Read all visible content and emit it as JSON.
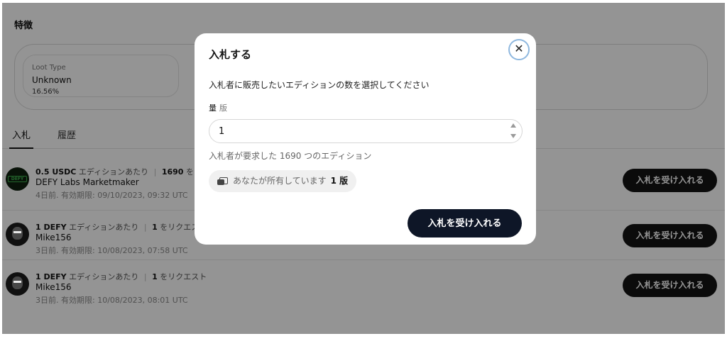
{
  "page": {
    "section_title": "特徴",
    "trait": {
      "type": "Loot Type",
      "value": "Unknown",
      "percent": "16.56%"
    },
    "tabs": [
      {
        "label": "入札",
        "active": true
      },
      {
        "label": "履歴",
        "active": false
      }
    ],
    "bids": [
      {
        "amount": "0.5 USDC",
        "per_edition": "エディションあたり",
        "count": "1690",
        "request_suffix": "を",
        "name": "DEFY Labs Marketmaker",
        "meta": "4日前. 有効期限: 09/10/2023, 09:32 UTC",
        "avatar_icon": "defy-logo-avatar",
        "accept_label": "入札を受け入れる"
      },
      {
        "amount": "1 DEFY",
        "per_edition": "エディションあたり",
        "count": "1",
        "request_suffix": "をリクエス",
        "name": "Mike156",
        "meta": "3日前. 有効期限: 10/08/2023, 07:58 UTC",
        "avatar_icon": "masked-figure-avatar",
        "accept_label": "入札を受け入れる"
      },
      {
        "amount": "1 DEFY",
        "per_edition": "エディションあたり",
        "count": "1",
        "request_suffix": "をリクエスト",
        "name": "Mike156",
        "meta": "3日前. 有効期限: 10/08/2023, 08:01 UTC",
        "avatar_icon": "masked-figure-avatar",
        "accept_label": "入札を受け入れる"
      }
    ]
  },
  "modal": {
    "title": "入札する",
    "close_icon": "close-icon",
    "close_symbol": "✕",
    "description": "入札者に販売したいエディションの数を選択してください",
    "quantity_label": "量",
    "quantity_unit": "版",
    "quantity_value": "1",
    "requested_text": "入札者が要求した 1690 つのエディション",
    "owned_text": "あなたが所有しています",
    "owned_count": "1 版",
    "owned_icon": "editions-icon",
    "accept_label": "入札を受け入れる"
  },
  "colors": {
    "primary_button": "#0e1627",
    "row_button": "#141414",
    "overlay": "rgba(0,0,0,0.42)",
    "close_ring": "#8fb8df",
    "defy_green": "#3fb34f"
  }
}
